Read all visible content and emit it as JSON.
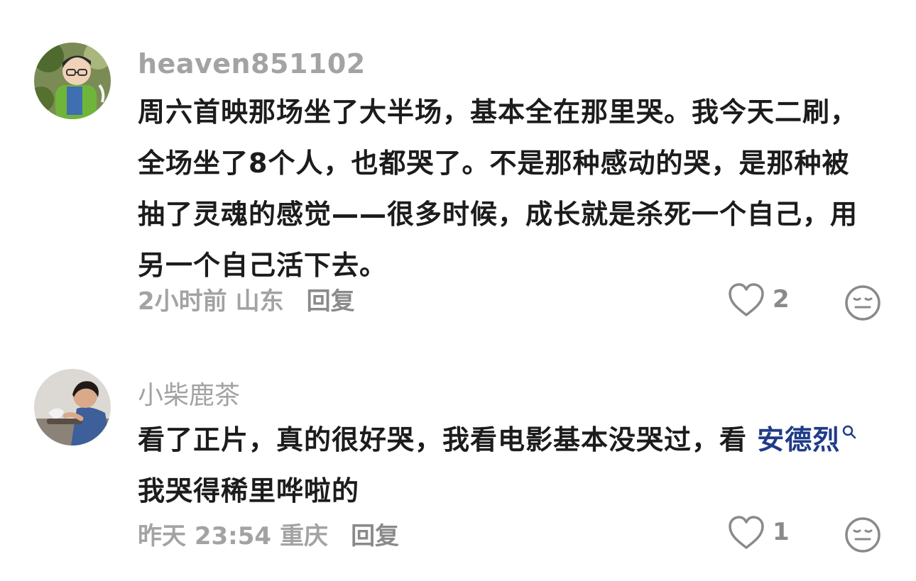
{
  "comments": [
    {
      "username": "heaven851102",
      "text": "周六首映那场坐了大半场，基本全在那里哭。我今天二刷，全场坐了8个人，也都哭了。不是那种感动的哭，是那种被抽了灵魂的感觉——很多时候，成长就是杀死一个自己，用另一个自己活下去。",
      "time": "2小时前",
      "location": "山东",
      "reply_label": "回复",
      "like_count": "2",
      "avatar_icon": "boy-portrait-avatar",
      "like_icon": "heart-outline-icon",
      "dislike_icon": "meh-face-icon"
    },
    {
      "username": "小柴鹿茶",
      "text_before": "看了正片，真的很好哭，我看电影基本没哭过，看 ",
      "mention": "安德烈",
      "text_after": "我哭得稀里哗啦的",
      "time": "昨天 23:54",
      "location": "重庆",
      "reply_label": "回复",
      "like_count": "1",
      "avatar_icon": "young-man-portrait-avatar",
      "mention_icon": "search-icon",
      "like_icon": "heart-outline-icon",
      "dislike_icon": "meh-face-icon"
    }
  ],
  "colors": {
    "username": "#a3a3a3",
    "body": "#1c1c1c",
    "meta": "#a3a3a3",
    "mention": "#1f3c88",
    "icon": "#8a8a8a"
  }
}
